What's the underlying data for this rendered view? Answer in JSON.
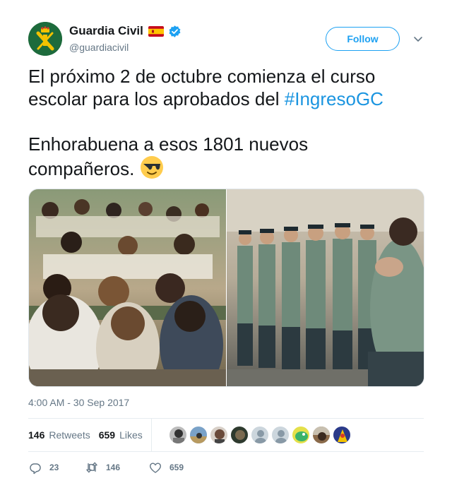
{
  "account": {
    "display_name": "Guardia Civil",
    "handle": "@guardiacivil",
    "flag_icon": "spain-flag-icon",
    "verified_icon": "verified-badge-icon"
  },
  "follow_label": "Follow",
  "tweet": {
    "line1": "El próximo 2 de octubre comienza el curso",
    "line2_prefix": "escolar para los aprobados del ",
    "hashtag": "#IngresoGC",
    "line3": "Enhorabuena a esos 1801 nuevos",
    "line4": "compañeros.",
    "emoji": "smiling-face-with-sunglasses"
  },
  "media": {
    "left_photo": "students-taking-exam-photo",
    "right_photo": "guardia-civil-cadets-in-formation-photo"
  },
  "timestamp": "4:00 AM - 30 Sep 2017",
  "stats": {
    "retweets_count": "146",
    "retweets_label": "Retweets",
    "likes_count": "659",
    "likes_label": "Likes",
    "liker_avatars": 9
  },
  "actions": {
    "reply_count": "23",
    "retweet_count": "146",
    "like_count": "659"
  },
  "colors": {
    "link": "#1b95e0",
    "follow": "#1da1f2",
    "muted": "#657786",
    "text": "#14171a",
    "divider": "#e6ecf0"
  }
}
